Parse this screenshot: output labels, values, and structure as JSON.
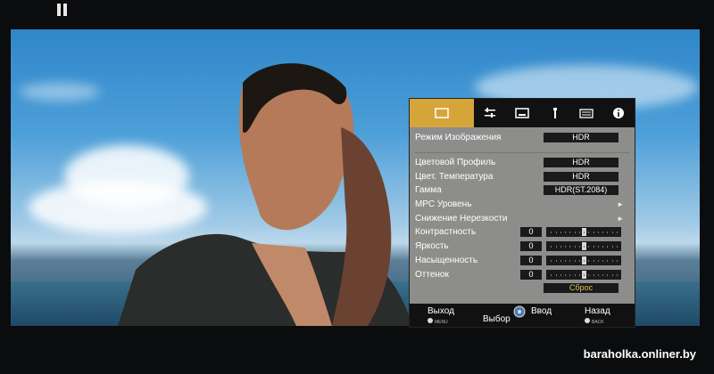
{
  "menu": {
    "tabs": [
      "picture-icon",
      "settings-icon",
      "display-icon",
      "wrench-icon",
      "keyboard-icon",
      "info-icon"
    ],
    "rows": {
      "picture_mode": {
        "label": "Режим Изображения",
        "value": "HDR"
      },
      "color_profile": {
        "label": "Цветовой Профиль",
        "value": "HDR"
      },
      "color_temp": {
        "label": "Цвет. Температура",
        "value": "HDR"
      },
      "gamma": {
        "label": "Гамма",
        "value": "HDR(ST.2084)"
      },
      "mpc_level": {
        "label": "МРС Уровень"
      },
      "noise_reduction": {
        "label": "Снижение Нерезкости"
      },
      "contrast": {
        "label": "Контрастность",
        "value": "0",
        "level": 0.5
      },
      "brightness": {
        "label": "Яркость",
        "value": "0",
        "level": 0.5
      },
      "saturation": {
        "label": "Насыщенность",
        "value": "0",
        "level": 0.5
      },
      "hue": {
        "label": "Оттенок",
        "value": "0",
        "level": 0.5
      }
    },
    "reset_label": "Сброс",
    "footer": {
      "exit": "Выход",
      "select": "Выбор",
      "enter": "Ввод",
      "back": "Назад",
      "menu_hint": "MENU",
      "back_hint": "BACK"
    }
  },
  "watermark": "baraholka.onliner.by"
}
